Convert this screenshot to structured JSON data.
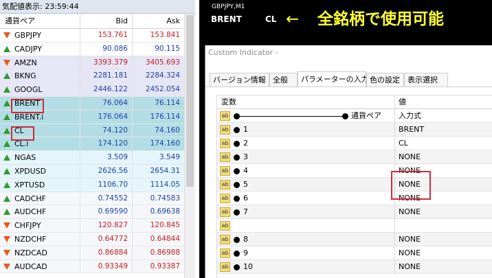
{
  "market_watch": {
    "title": "気配値表示: 23:59:44",
    "columns": {
      "symbol": "通貨ペア",
      "bid": "Bid",
      "ask": "Ask"
    },
    "rows": [
      {
        "symbol": "GBPJPY",
        "bid": "153.761",
        "ask": "153.841",
        "dir": "down",
        "color": "red",
        "bg": "w"
      },
      {
        "symbol": "CADJPY",
        "bid": "90.086",
        "ask": "90.115",
        "dir": "up",
        "color": "blue",
        "bg": "w"
      },
      {
        "symbol": "AMZN",
        "bid": "3393.379",
        "ask": "3405.693",
        "dir": "down",
        "color": "red",
        "bg": "l"
      },
      {
        "symbol": "BKNG",
        "bid": "2281.181",
        "ask": "2284.324",
        "dir": "up",
        "color": "blue",
        "bg": "l"
      },
      {
        "symbol": "GOOGL",
        "bid": "2446.122",
        "ask": "2452.054",
        "dir": "up",
        "color": "blue",
        "bg": "l"
      },
      {
        "symbol": "BRENT",
        "bid": "76.064",
        "ask": "76.114",
        "dir": "up",
        "color": "blue",
        "bg": "t"
      },
      {
        "symbol": "BRENT.i",
        "bid": "176.064",
        "ask": "176.114",
        "dir": "up",
        "color": "blue",
        "bg": "t"
      },
      {
        "symbol": "CL",
        "bid": "74.120",
        "ask": "74.160",
        "dir": "up",
        "color": "blue",
        "bg": "t"
      },
      {
        "symbol": "CL.i",
        "bid": "174.120",
        "ask": "174.160",
        "dir": "up",
        "color": "blue",
        "bg": "t"
      },
      {
        "symbol": "NGAS",
        "bid": "3.509",
        "ask": "3.549",
        "dir": "up",
        "color": "blue",
        "bg": "c"
      },
      {
        "symbol": "XPDUSD",
        "bid": "2626.56",
        "ask": "2654.31",
        "dir": "up",
        "color": "blue",
        "bg": "c"
      },
      {
        "symbol": "XPTUSD",
        "bid": "1106.70",
        "ask": "1114.05",
        "dir": "up",
        "color": "blue",
        "bg": "c"
      },
      {
        "symbol": "CADCHF",
        "bid": "0.74552",
        "ask": "0.74583",
        "dir": "up",
        "color": "blue",
        "bg": "p"
      },
      {
        "symbol": "AUDCHF",
        "bid": "0.69590",
        "ask": "0.69638",
        "dir": "up",
        "color": "blue",
        "bg": "p"
      },
      {
        "symbol": "CHFJPY",
        "bid": "120.827",
        "ask": "120.845",
        "dir": "down",
        "color": "red",
        "bg": "p"
      },
      {
        "symbol": "NZDCHF",
        "bid": "0.64772",
        "ask": "0.64844",
        "dir": "down",
        "color": "red",
        "bg": "p"
      },
      {
        "symbol": "NZDCAD",
        "bid": "0.86884",
        "ask": "0.86988",
        "dir": "down",
        "color": "red",
        "bg": "p"
      },
      {
        "symbol": "AUDCAD",
        "bid": "0.93349",
        "ask": "0.93387",
        "dir": "down",
        "color": "red",
        "bg": "p"
      }
    ],
    "highlighted_symbols": [
      "BRENT",
      "CL"
    ]
  },
  "chart_window": {
    "title": "GBPJPY,M1",
    "annotation": {
      "label_1": "BRENT",
      "label_2": "CL",
      "arrow": "←",
      "text": "全銘柄で使用可能",
      "color": "#ffff33"
    }
  },
  "dialog": {
    "title": "Custom Indicator -",
    "tabs": [
      "バージョン情報",
      "全般",
      "パラメーターの入力",
      "色の設定",
      "表示選択"
    ],
    "active_tab": 2,
    "table": {
      "col_variable": "変数",
      "col_value": "値",
      "rows": [
        {
          "name": "通貨ペア",
          "value": "入力式",
          "style": "line"
        },
        {
          "name": "1",
          "value": "BRENT",
          "style": "dot"
        },
        {
          "name": "2",
          "value": "CL",
          "style": "dot"
        },
        {
          "name": "3",
          "value": "NONE",
          "style": "dot"
        },
        {
          "name": "4",
          "value": "NONE",
          "style": "dot"
        },
        {
          "name": "5",
          "value": "NONE",
          "style": "dot"
        },
        {
          "name": "6",
          "value": "NONE",
          "style": "dot"
        },
        {
          "name": "7",
          "value": "NONE",
          "style": "dot"
        },
        {
          "name": "",
          "value": "",
          "style": "empty"
        },
        {
          "name": "8",
          "value": "NONE",
          "style": "dot"
        },
        {
          "name": "9",
          "value": "NONE",
          "style": "dot"
        },
        {
          "name": "10",
          "value": "NONE",
          "style": "dot"
        }
      ]
    }
  }
}
